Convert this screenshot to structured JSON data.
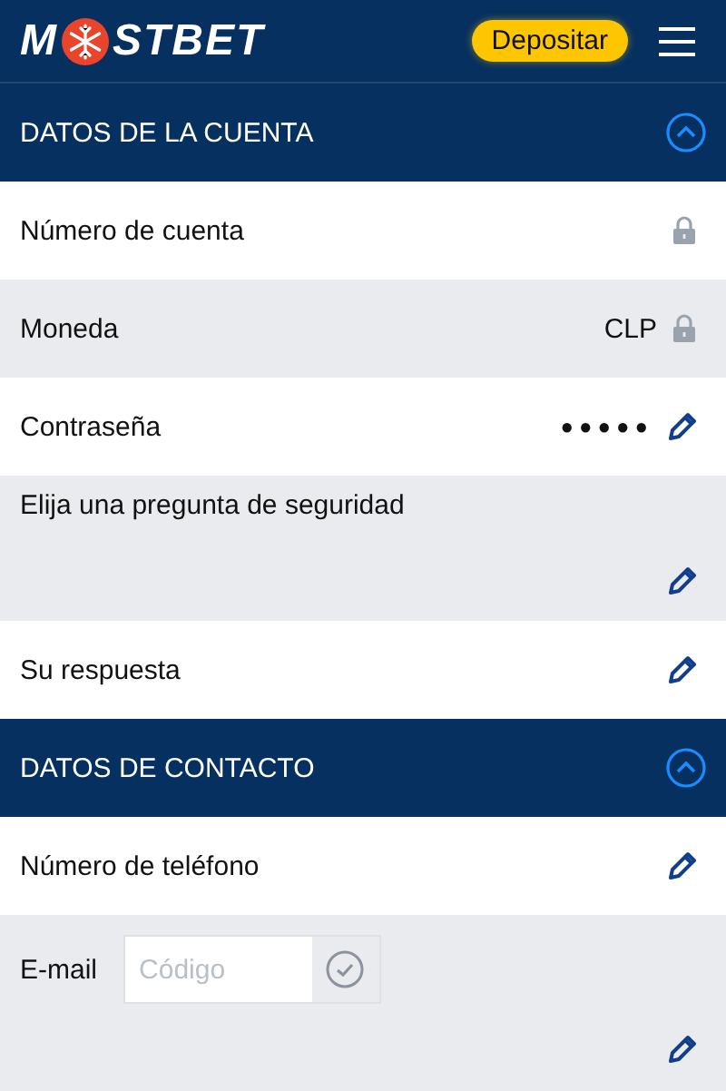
{
  "header": {
    "logo": {
      "before": "M",
      "after": "STBET"
    },
    "deposit_button": "Depositar"
  },
  "sections": [
    {
      "title": "DATOS DE LA CUENTA",
      "expanded": true,
      "rows": [
        {
          "kind": "locked",
          "label": "Número de cuenta"
        },
        {
          "kind": "locked",
          "label": "Moneda",
          "value": "CLP"
        },
        {
          "kind": "edit",
          "label": "Contraseña",
          "value": "●●●●●"
        },
        {
          "kind": "tall",
          "label": "Elija una pregunta de seguridad"
        },
        {
          "kind": "edit",
          "label": "Su respuesta"
        }
      ]
    },
    {
      "title": "DATOS DE CONTACTO",
      "expanded": true,
      "rows": [
        {
          "kind": "edit",
          "label": "Número de teléfono"
        },
        {
          "kind": "code",
          "label": "E-mail",
          "placeholder": "Código"
        }
      ]
    }
  ]
}
